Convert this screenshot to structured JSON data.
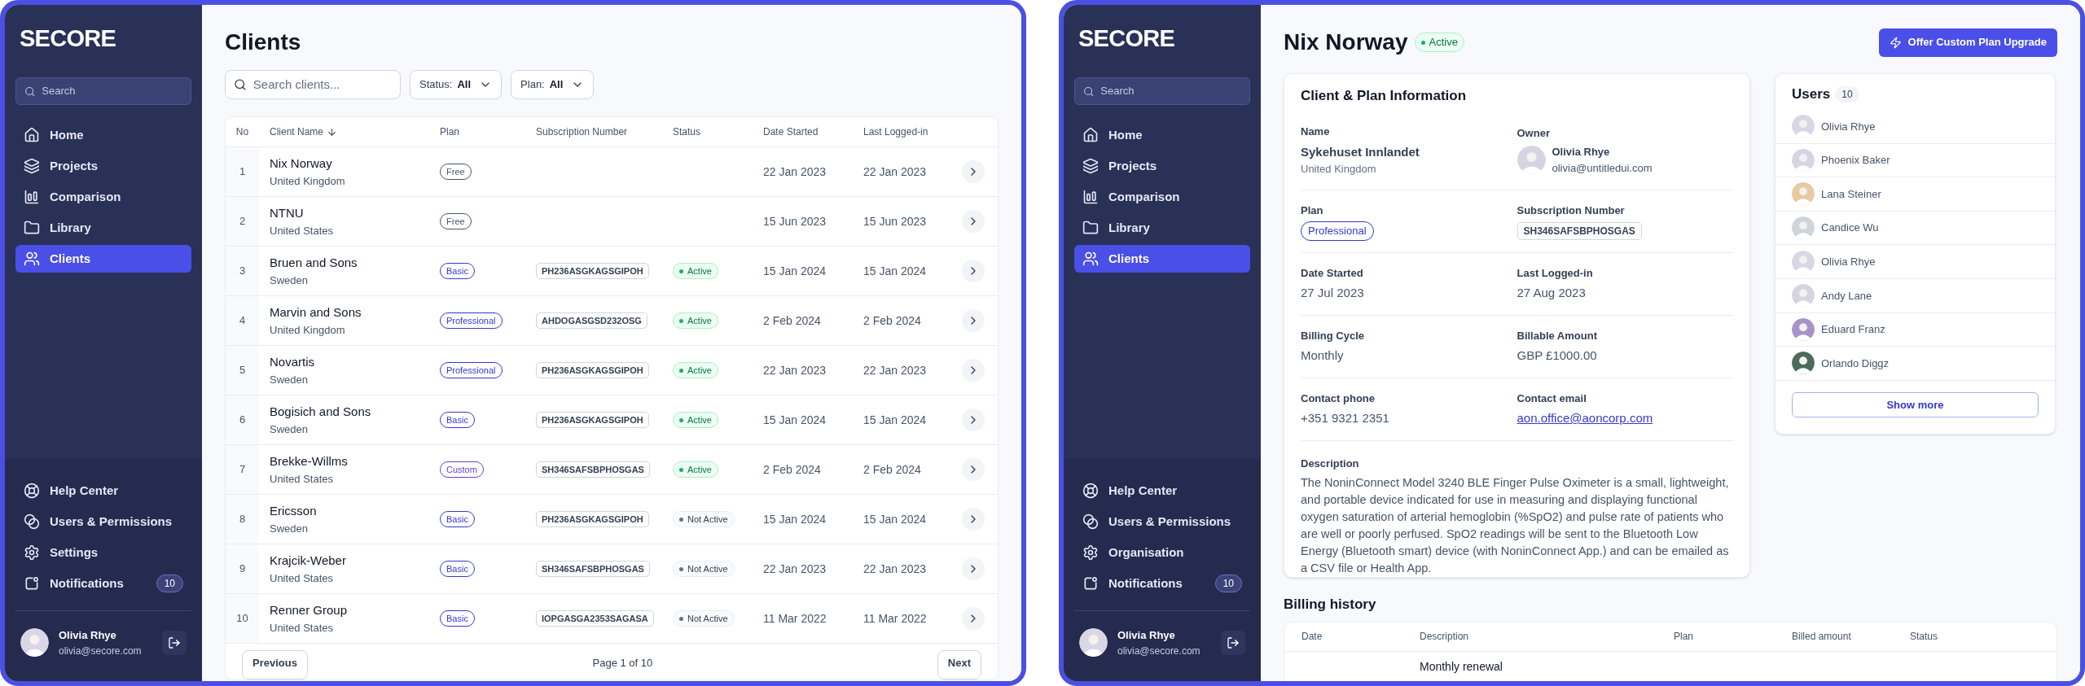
{
  "panels": [
    {
      "kind": "clients_list",
      "sidebar": {
        "logo": "SECORE",
        "search": {
          "placeholder": "Search"
        },
        "nav": [
          {
            "label": "Home",
            "selected": false
          },
          {
            "label": "Projects",
            "selected": false
          },
          {
            "label": "Comparison",
            "selected": false
          },
          {
            "label": "Library",
            "selected": false
          },
          {
            "label": "Clients",
            "selected": true
          }
        ],
        "footer_nav": [
          {
            "label": "Help Center",
            "selected": false
          },
          {
            "label": "Users & Permissions",
            "selected": false
          },
          {
            "label": "Settings",
            "selected": false
          },
          {
            "label": "Notifications",
            "selected": false,
            "badge": "10"
          }
        ],
        "user": {
          "name": "Olivia Rhye",
          "email": "olivia@secore.com"
        }
      },
      "page": {
        "title": "Clients",
        "search": {
          "placeholder": "Search clients..."
        },
        "filters": [
          {
            "label": "Status:",
            "value": "All"
          },
          {
            "label": "Plan:",
            "value": "All"
          }
        ],
        "table": {
          "columns": [
            "No",
            "Client Name",
            "Plan",
            "Subscription Number",
            "Status",
            "Date Started",
            "Last Logged-in"
          ],
          "rows": [
            {
              "no": "1",
              "name": "Nix Norway",
              "country": "United Kingdom",
              "plan": {
                "label": "Free",
                "color": "#475467"
              },
              "date_started": "22 Jan 2023",
              "last_logged_in": "22 Jan 2023"
            },
            {
              "no": "2",
              "name": "NTNU",
              "country": "United States",
              "plan": {
                "label": "Free",
                "color": "#475467"
              },
              "date_started": "15 Jun 2023",
              "last_logged_in": "15 Jun 2023"
            },
            {
              "no": "3",
              "name": "Bruen and Sons",
              "country": "Sweden",
              "plan": {
                "label": "Basic",
                "color": "#3538cd"
              },
              "subscription": "PH236ASGKAGSGIPOH",
              "status": {
                "label": "Active",
                "active": true
              },
              "date_started": "15 Jan 2024",
              "last_logged_in": "15 Jan 2024"
            },
            {
              "no": "4",
              "name": "Marvin and Sons",
              "country": "United Kingdom",
              "plan": {
                "label": "Professional",
                "color": "#3538cd"
              },
              "subscription": "AHDOGASGSD232OSG",
              "status": {
                "label": "Active",
                "active": true
              },
              "date_started": "2 Feb 2024",
              "last_logged_in": "2 Feb 2024"
            },
            {
              "no": "5",
              "name": "Novartis",
              "country": "Sweden",
              "plan": {
                "label": "Professional",
                "color": "#3538cd"
              },
              "subscription": "PH236ASGKAGSGIPOH",
              "status": {
                "label": "Active",
                "active": true
              },
              "date_started": "22 Jan 2023",
              "last_logged_in": "22 Jan 2023"
            },
            {
              "no": "6",
              "name": "Bogisich and Sons",
              "country": "Sweden",
              "plan": {
                "label": "Basic",
                "color": "#3538cd"
              },
              "subscription": "PH236ASGKAGSGIPOH",
              "status": {
                "label": "Active",
                "active": true
              },
              "date_started": "15 Jan 2024",
              "last_logged_in": "15 Jan 2024"
            },
            {
              "no": "7",
              "name": "Brekke-Willms",
              "country": "United States",
              "plan": {
                "label": "Custom",
                "color": "#6941c6"
              },
              "subscription": "SH346SAFSBPHOSGAS",
              "status": {
                "label": "Active",
                "active": true
              },
              "date_started": "2 Feb 2024",
              "last_logged_in": "2 Feb 2024"
            },
            {
              "no": "8",
              "name": "Ericsson",
              "country": "Sweden",
              "plan": {
                "label": "Basic",
                "color": "#3538cd"
              },
              "subscription": "PH236ASGKAGSGIPOH",
              "status": {
                "label": "Not Active",
                "active": false
              },
              "date_started": "15 Jan 2024",
              "last_logged_in": "15 Jan 2024"
            },
            {
              "no": "9",
              "name": "Krajcik-Weber",
              "country": "United States",
              "plan": {
                "label": "Basic",
                "color": "#3538cd"
              },
              "subscription": "SH346SAFSBPHOSGAS",
              "status": {
                "label": "Not Active",
                "active": false
              },
              "date_started": "22 Jan 2023",
              "last_logged_in": "22 Jan 2023"
            },
            {
              "no": "10",
              "name": "Renner Group",
              "country": "United States",
              "plan": {
                "label": "Basic",
                "color": "#3538cd"
              },
              "subscription": "IOPGASGA2353SAGASA",
              "status": {
                "label": "Not Active",
                "active": false
              },
              "date_started": "11 Mar 2022",
              "last_logged_in": "11 Mar 2022"
            }
          ]
        },
        "pagination": {
          "previous": "Previous",
          "page": "Page 1 of 10",
          "next": "Next"
        }
      }
    },
    {
      "kind": "client_detail",
      "sidebar": {
        "logo": "SECORE",
        "search": {
          "placeholder": "Search"
        },
        "nav": [
          {
            "label": "Home",
            "selected": false
          },
          {
            "label": "Projects",
            "selected": false
          },
          {
            "label": "Comparison",
            "selected": false
          },
          {
            "label": "Library",
            "selected": false
          },
          {
            "label": "Clients",
            "selected": true
          }
        ],
        "footer_nav": [
          {
            "label": "Help Center",
            "selected": false
          },
          {
            "label": "Users & Permissions",
            "selected": false
          },
          {
            "label": "Organisation",
            "selected": false
          },
          {
            "label": "Notifications",
            "selected": false,
            "badge": "10"
          }
        ],
        "user": {
          "name": "Olivia Rhye",
          "email": "olivia@secore.com"
        }
      },
      "page": {
        "title": "Nix Norway",
        "status": {
          "label": "Active",
          "active": true
        },
        "action": "Offer Custom Plan Upgrade",
        "info_card": {
          "title": "Client & Plan Information",
          "rows": [
            [
              {
                "kind": "text",
                "label": "Name",
                "value": "Sykehuset Innlandet",
                "sub": "United Kingdom"
              },
              {
                "kind": "person",
                "label": "Owner",
                "name": "Olivia Rhye",
                "email": "olivia@untitledui.com"
              }
            ],
            [
              {
                "kind": "badge",
                "label": "Plan",
                "value": "Professional",
                "color": "#3538cd"
              },
              {
                "kind": "code",
                "label": "Subscription Number",
                "value": "SH346SAFSBPHOSGAS"
              }
            ],
            [
              {
                "kind": "text",
                "label": "Date Started",
                "value": "27 Jul 2023"
              },
              {
                "kind": "text",
                "label": "Last Logged-in",
                "value": "27 Aug 2023"
              }
            ],
            [
              {
                "kind": "text",
                "label": "Billing Cycle",
                "value": "Monthly"
              },
              {
                "kind": "text",
                "label": "Billable Amount",
                "value": "GBP £1000.00"
              }
            ],
            [
              {
                "kind": "text",
                "label": "Contact phone",
                "value": "+351 9321 2351"
              },
              {
                "kind": "link",
                "label": "Contact email",
                "value": "aon.office@aoncorp.com"
              }
            ]
          ],
          "description": {
            "label": "Description",
            "text": "The NoninConnect Model 3240 BLE Finger Pulse Oximeter is a small, lightweight, and portable device indicated for use in measuring and displaying functional oxygen saturation of arterial hemoglobin (%SpO2) and pulse rate of patients who are well or poorly perfused. SpO2 readings will be sent to the Bluetooth Low Energy (Bluetooth smart) device (with NoninConnect App.) and can be emailed as a CSV file or Health App."
          }
        },
        "users_card": {
          "title": "Users",
          "count": "10",
          "users": [
            "Olivia Rhye",
            "Phoenix Baker",
            "Lana Steiner",
            "Candice Wu",
            "Olivia Rhye",
            "Andy Lane",
            "Eduard Franz",
            "Orlando Diggz"
          ],
          "show_more": "Show more"
        },
        "billing": {
          "title": "Billing history",
          "columns": [
            "Date",
            "Description",
            "Plan",
            "Billed amount",
            "Status"
          ],
          "rows": [
            {
              "description": "Monthly renewal"
            }
          ]
        }
      }
    }
  ]
}
